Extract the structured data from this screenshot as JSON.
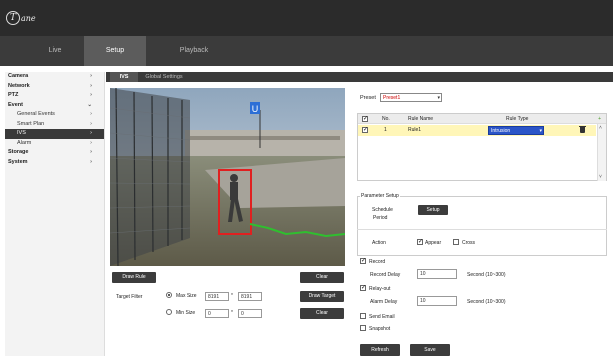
{
  "header": {
    "logo_mark": "T",
    "logo_text": "ane"
  },
  "nav": {
    "live": "Live",
    "setup": "Setup",
    "playback": "Playback"
  },
  "sidebar": {
    "items": [
      {
        "label": "Camera",
        "chev": "›"
      },
      {
        "label": "Network",
        "chev": "›"
      },
      {
        "label": "PTZ",
        "chev": "›"
      },
      {
        "label": "Event",
        "chev": "⌄"
      },
      {
        "label": "General Events",
        "chev": "›"
      },
      {
        "label": "Smart Plan",
        "chev": "›"
      },
      {
        "label": "IVS",
        "chev": "›"
      },
      {
        "label": "Alarm",
        "chev": "›"
      },
      {
        "label": "Storage",
        "chev": "›"
      },
      {
        "label": "System",
        "chev": "›"
      }
    ]
  },
  "subtabs": {
    "ivs": "IVS",
    "global": "Global Settings"
  },
  "video": {
    "rule_marker": "U",
    "colors": {
      "target_box": "#e02020",
      "tripwire": "#2fbf2f",
      "rule_marker": "#2d6fd6"
    }
  },
  "video_controls": {
    "draw_rule": "Draw Rule",
    "clear": "Clear",
    "target_filter": "Target Filter",
    "max_size": "Max Size",
    "max_w": "8191",
    "max_h": "8191",
    "min_size": "Min Size",
    "min_w": "0",
    "min_h": "0",
    "times": "*",
    "draw_target": "Draw Target",
    "clear2": "Clear"
  },
  "rules": {
    "preset_label": "Preset",
    "preset_value": "Preset1",
    "headers": {
      "no": "No.",
      "name": "Rule Name",
      "type": "Rule Type",
      "add": "+"
    },
    "rows": [
      {
        "no": "1",
        "name": "Rule1",
        "type": "Intrusion"
      }
    ]
  },
  "params": {
    "title": "Parameter Setup",
    "schedule_label": "Schedule",
    "period_label": "Period",
    "setup_button": "Setup",
    "action_label": "Action",
    "appear_label": "Appear",
    "close_label": "Cross",
    "record_label": "Record",
    "record_delay_label": "Record Delay",
    "record_delay_value": "10",
    "record_delay_unit": "Second (10~300)",
    "relay_label": "Relay-out",
    "alarm_delay_label": "Alarm Delay",
    "alarm_delay_value": "10",
    "alarm_delay_unit": "Second (10~300)",
    "email_label": "Send Email",
    "snapshot_label": "Snapshot"
  },
  "footer": {
    "refresh": "Refresh",
    "save": "Save"
  }
}
